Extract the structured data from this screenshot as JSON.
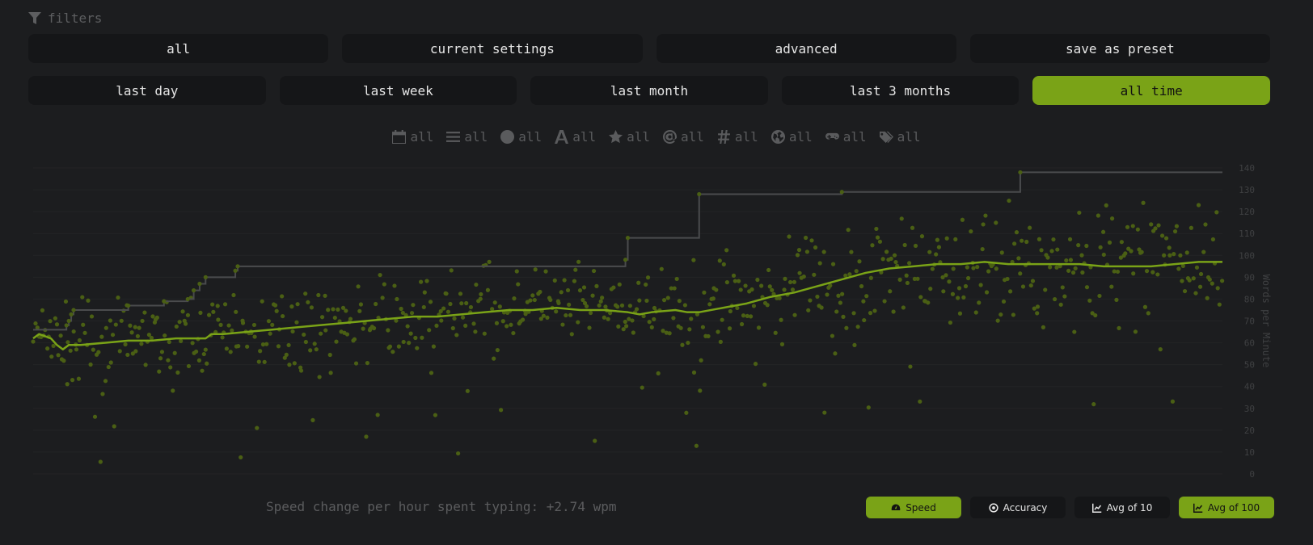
{
  "filters_label": "filters",
  "row1": [
    "all",
    "current settings",
    "advanced",
    "save as preset"
  ],
  "row2": [
    {
      "label": "last day",
      "active": false
    },
    {
      "label": "last week",
      "active": false
    },
    {
      "label": "last month",
      "active": false
    },
    {
      "label": "last 3 months",
      "active": false
    },
    {
      "label": "all time",
      "active": true
    }
  ],
  "subfilters": [
    {
      "icon": "calendar-icon",
      "label": "all"
    },
    {
      "icon": "list-icon",
      "label": "all"
    },
    {
      "icon": "clock-icon",
      "label": "all"
    },
    {
      "icon": "font-icon",
      "label": "all"
    },
    {
      "icon": "star-icon",
      "label": "all"
    },
    {
      "icon": "at-icon",
      "label": "all"
    },
    {
      "icon": "hashtag-icon",
      "label": "all"
    },
    {
      "icon": "globe-icon",
      "label": "all"
    },
    {
      "icon": "gamepad-icon",
      "label": "all"
    },
    {
      "icon": "tags-icon",
      "label": "all"
    }
  ],
  "colors": {
    "accent": "#7aa317",
    "dots": "#4a5f14",
    "pb_line": "#4a4b4d",
    "grid": "#232426",
    "muted": "#5b5c5e"
  },
  "speed_change": "Speed change per hour spent typing: +2.74 wpm",
  "toggles": [
    {
      "icon": "gauge-icon",
      "label": "Speed",
      "on": true
    },
    {
      "icon": "target-icon",
      "label": "Accuracy",
      "on": false
    },
    {
      "icon": "chart-line-icon",
      "label": "Avg of 10",
      "on": false
    },
    {
      "icon": "chart-line-icon",
      "label": "Avg of 100",
      "on": true
    }
  ],
  "chart_data": {
    "type": "scatter",
    "ylabel": "Words per Minute",
    "ylim": [
      0,
      140
    ],
    "y_ticks": [
      0,
      10,
      20,
      30,
      40,
      50,
      60,
      70,
      80,
      90,
      100,
      110,
      120,
      130,
      140
    ],
    "x_range": [
      0,
      1000
    ],
    "series": [
      {
        "kind": "step-line",
        "points": [
          [
            0,
            66
          ],
          [
            28,
            66
          ],
          [
            28,
            68
          ],
          [
            30,
            68
          ],
          [
            30,
            70
          ],
          [
            32,
            70
          ],
          [
            32,
            73
          ],
          [
            34,
            73
          ],
          [
            34,
            75
          ],
          [
            80,
            75
          ],
          [
            80,
            77
          ],
          [
            110,
            77
          ],
          [
            110,
            79
          ],
          [
            130,
            79
          ],
          [
            130,
            80
          ],
          [
            135,
            80
          ],
          [
            135,
            84
          ],
          [
            140,
            84
          ],
          [
            140,
            87
          ],
          [
            145,
            87
          ],
          [
            145,
            90
          ],
          [
            170,
            90
          ],
          [
            170,
            93
          ],
          [
            172,
            93
          ],
          [
            172,
            95
          ],
          [
            400,
            95
          ],
          [
            400,
            95
          ],
          [
            498,
            95
          ],
          [
            498,
            98
          ],
          [
            500,
            98
          ],
          [
            500,
            108
          ],
          [
            560,
            108
          ],
          [
            560,
            128
          ],
          [
            680,
            128
          ],
          [
            680,
            129
          ],
          [
            830,
            129
          ],
          [
            830,
            138
          ],
          [
            1000,
            138
          ]
        ]
      },
      {
        "kind": "moving-average",
        "points": [
          [
            0,
            62
          ],
          [
            5,
            64
          ],
          [
            10,
            63
          ],
          [
            15,
            62
          ],
          [
            20,
            59
          ],
          [
            25,
            57
          ],
          [
            30,
            59
          ],
          [
            40,
            59
          ],
          [
            60,
            60
          ],
          [
            80,
            61
          ],
          [
            100,
            61
          ],
          [
            120,
            62
          ],
          [
            140,
            62
          ],
          [
            145,
            62
          ],
          [
            150,
            64
          ],
          [
            160,
            64
          ],
          [
            180,
            65
          ],
          [
            200,
            66
          ],
          [
            220,
            67
          ],
          [
            240,
            68
          ],
          [
            260,
            69
          ],
          [
            280,
            70
          ],
          [
            300,
            71
          ],
          [
            320,
            72
          ],
          [
            340,
            72
          ],
          [
            360,
            73
          ],
          [
            380,
            74
          ],
          [
            400,
            75
          ],
          [
            420,
            75
          ],
          [
            440,
            76
          ],
          [
            460,
            75
          ],
          [
            480,
            75
          ],
          [
            500,
            74
          ],
          [
            510,
            73
          ],
          [
            520,
            74
          ],
          [
            540,
            75
          ],
          [
            550,
            74
          ],
          [
            560,
            74
          ],
          [
            580,
            76
          ],
          [
            600,
            78
          ],
          [
            620,
            81
          ],
          [
            640,
            83
          ],
          [
            660,
            86
          ],
          [
            680,
            89
          ],
          [
            700,
            92
          ],
          [
            720,
            94
          ],
          [
            740,
            95
          ],
          [
            760,
            96
          ],
          [
            780,
            96
          ],
          [
            800,
            97
          ],
          [
            820,
            96
          ],
          [
            840,
            96
          ],
          [
            860,
            96
          ],
          [
            880,
            96
          ],
          [
            900,
            95
          ],
          [
            920,
            95
          ],
          [
            940,
            95
          ],
          [
            960,
            96
          ],
          [
            980,
            97
          ],
          [
            1000,
            97
          ]
        ]
      }
    ]
  }
}
